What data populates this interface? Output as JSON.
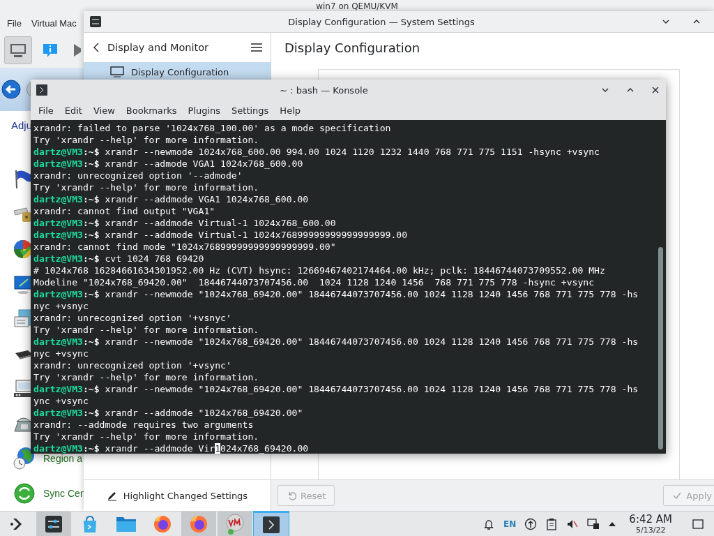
{
  "vm_window": {
    "title": "win7 on QEMU/KVM",
    "menu": [
      "File",
      "Virtual Mac"
    ],
    "toolbar": [
      {
        "selected": true
      },
      {
        "selected": false
      },
      {
        "selected": false
      }
    ],
    "guest": {
      "heading": "Adju",
      "item_labels": [
        "Region a",
        "Sync Cen"
      ]
    }
  },
  "system_settings": {
    "title": "Display Configuration — System Settings",
    "sidebar": {
      "title": "Display and Monitor",
      "items": [
        {
          "label": "Display Configuration",
          "selected": true
        }
      ],
      "footer_button": "Highlight Changed Settings"
    },
    "page": {
      "title": "Display Configuration"
    },
    "buttons": [
      {
        "label": "Reset",
        "disabled": true
      },
      {
        "label": "Apply",
        "disabled": true
      }
    ]
  },
  "konsole": {
    "title": "~ : bash — Konsole",
    "menu": [
      "File",
      "Edit",
      "View",
      "Bookmarks",
      "Plugins",
      "Settings",
      "Help"
    ],
    "lines": [
      {
        "kind": "output",
        "text": "xrandr: failed to parse '1024x768_100.00' as a mode specification"
      },
      {
        "kind": "output",
        "text": "Try 'xrandr --help' for more information."
      },
      {
        "kind": "prompt",
        "user": "dartz@VM3",
        "tail": ":~$",
        "command": "xrandr --newmode 1024x768_600.00 994.00 1024 1120 1232 1440 768 771 775 1151 -hsync +vsync"
      },
      {
        "kind": "prompt",
        "user": "dartz@VM3",
        "tail": ":~$",
        "command": "xrandr --admode VGA1 1024x768_600.00"
      },
      {
        "kind": "output",
        "text": "xrandr: unrecognized option '--admode'"
      },
      {
        "kind": "output",
        "text": "Try 'xrandr --help' for more information."
      },
      {
        "kind": "prompt",
        "user": "dartz@VM3",
        "tail": ":~$",
        "command": "xrandr --addmode VGA1 1024x768_600.00"
      },
      {
        "kind": "output",
        "text": "xrandr: cannot find output \"VGA1\""
      },
      {
        "kind": "prompt",
        "user": "dartz@VM3",
        "tail": ":~$",
        "command": "xrandr --addmode Virtual-1 1024x768_600.00"
      },
      {
        "kind": "prompt",
        "user": "dartz@VM3",
        "tail": ":~$",
        "command": "xrandr --addmode Virtual-1 1024x76899999999999999999.00"
      },
      {
        "kind": "output",
        "text": "xrandr: cannot find mode \"1024x76899999999999999999.00\""
      },
      {
        "kind": "prompt",
        "user": "dartz@VM3",
        "tail": ":~$",
        "command": "cvt 1024 768 69420"
      },
      {
        "kind": "output",
        "text": "# 1024x768 16284661634301952.00 Hz (CVT) hsync: 12669467402174464.00 kHz; pclk: 18446744073709552.00 MHz"
      },
      {
        "kind": "output",
        "text": "Modeline \"1024x768_69420.00\"  18446744073707456.00  1024 1128 1240 1456  768 771 775 778 -hsync +vsync"
      },
      {
        "kind": "prompt",
        "user": "dartz@VM3",
        "tail": ":~$",
        "command": "xrandr --newmode \"1024x768_69420.00\" 18446744073707456.00 1024 1128 1240 1456 768 771 775 778 -hs"
      },
      {
        "kind": "output",
        "text": "nyc +vsnyc"
      },
      {
        "kind": "output",
        "text": "xrandr: unrecognized option '+vsnyc'"
      },
      {
        "kind": "output",
        "text": "Try 'xrandr --help' for more information."
      },
      {
        "kind": "prompt",
        "user": "dartz@VM3",
        "tail": ":~$",
        "command": "xrandr --newmode \"1024x768_69420.00\" 18446744073707456.00 1024 1128 1240 1456 768 771 775 778 -hs"
      },
      {
        "kind": "output",
        "text": "nyc +vsync"
      },
      {
        "kind": "output",
        "text": "xrandr: unrecognized option '+vsync'"
      },
      {
        "kind": "output",
        "text": "Try 'xrandr --help' for more information."
      },
      {
        "kind": "prompt",
        "user": "dartz@VM3",
        "tail": ":~$",
        "command": "xrandr --newmode \"1024x768_69420.00\" 18446744073707456.00 1024 1128 1240 1456 768 771 775 778 -hs"
      },
      {
        "kind": "output",
        "text": "ync +vsync"
      },
      {
        "kind": "prompt",
        "user": "dartz@VM3",
        "tail": ":~$",
        "command": "xrandr --addmode \"1024x768_69420.00\""
      },
      {
        "kind": "output",
        "text": "xrandr: --addmode requires two arguments"
      },
      {
        "kind": "output",
        "text": "Try 'xrandr --help' for more information."
      },
      {
        "kind": "prompt",
        "user": "dartz@VM3",
        "tail": ":~$",
        "command": "xrandr --addmode Vir",
        "cursor": "1",
        "command_rest": "024x768_69420.00"
      }
    ]
  },
  "taskbar": {
    "items": [
      {
        "open": false,
        "active": false
      },
      {
        "open": true,
        "active": false
      },
      {
        "open": false,
        "active": false
      },
      {
        "open": false,
        "active": false
      },
      {
        "open": false,
        "active": false
      },
      {
        "open": true,
        "active": false
      },
      {
        "open": true,
        "active": false
      },
      {
        "open": true,
        "active": true
      }
    ],
    "language": "EN",
    "time": "6:42 AM",
    "date": "5/13/22"
  }
}
